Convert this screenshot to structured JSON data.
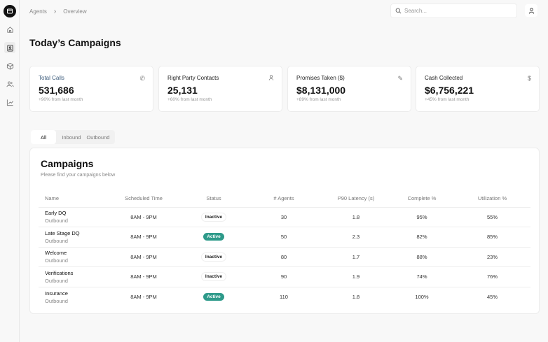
{
  "breadcrumb": [
    "Agents",
    "Overview"
  ],
  "search": {
    "placeholder": "Search..."
  },
  "page_title": "Today’s Campaigns",
  "stats": [
    {
      "title": "Total Calls",
      "value": "531,686",
      "sub": "+90% from last month",
      "icon": "phone-icon"
    },
    {
      "title": "Right Party Contacts",
      "value": "25,131",
      "sub": "+60% from last month",
      "icon": "user-icon"
    },
    {
      "title": "Promises Taken ($)",
      "value": "$8,131,000",
      "sub": "+89% from last month",
      "icon": "pencil-icon"
    },
    {
      "title": "Cash Collected",
      "value": "$6,756,221",
      "sub": "+45% from last month",
      "icon": "dollar-icon"
    }
  ],
  "tabs": [
    "All",
    "Inbound",
    "Outbound"
  ],
  "campaigns": {
    "title": "Campaigns",
    "subtitle": "Please find your campaigns below",
    "columns": [
      "Name",
      "Scheduled Time",
      "Status",
      "# Agents",
      "P90 Latency (s)",
      "Complete %",
      "Utilization %"
    ],
    "rows": [
      {
        "name": "Early DQ",
        "type": "Outbound",
        "time": "8AM - 9PM",
        "status": "Inactive",
        "agents": "30",
        "latency": "1.8",
        "complete": "95%",
        "util": "55%"
      },
      {
        "name": "Late Stage DQ",
        "type": "Outbound",
        "time": "8AM - 9PM",
        "status": "Active",
        "agents": "50",
        "latency": "2.3",
        "complete": "82%",
        "util": "85%"
      },
      {
        "name": "Welcome",
        "type": "Outbound",
        "time": "8AM - 9PM",
        "status": "Inactive",
        "agents": "80",
        "latency": "1.7",
        "complete": "88%",
        "util": "23%"
      },
      {
        "name": "Verifications",
        "type": "Outbound",
        "time": "8AM - 9PM",
        "status": "Inactive",
        "agents": "90",
        "latency": "1.9",
        "complete": "74%",
        "util": "76%"
      },
      {
        "name": "Insurance",
        "type": "Outbound",
        "time": "8AM - 9PM",
        "status": "Active",
        "agents": "110",
        "latency": "1.8",
        "complete": "100%",
        "util": "45%"
      }
    ]
  },
  "colors": {
    "active": "#2e9a8a",
    "accent_title": "#3a5a7a"
  }
}
